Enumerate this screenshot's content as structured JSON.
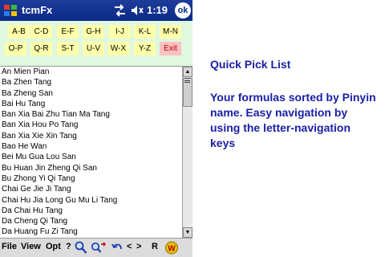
{
  "titlebar": {
    "app_title": "tcmFx",
    "time": "1:19",
    "ok_label": "ok"
  },
  "letter_nav": {
    "keys": [
      "A-B",
      "C-D",
      "E-F",
      "G-H",
      "I-J",
      "K-L",
      "M-N",
      "O-P",
      "Q-R",
      "S-T",
      "U-V",
      "W-X",
      "Y-Z"
    ],
    "exit_label": "Exit"
  },
  "list": {
    "items": [
      "An Mien Pian",
      "Ba Zhen Tang",
      "Ba Zheng San",
      "Bai Hu Tang",
      "Ban Xia Bai Zhu Tian Ma Tang",
      "Ban Xia Hou Po Tang",
      "Ban Xia Xie Xin Tang",
      "Bao He Wan",
      "Bei Mu Gua Lou San",
      "Bu Huan Jin Zheng Qi San",
      "Bu Zhong Yi Qi Tang",
      "Chai Ge Jie Ji Tang",
      "Chai Hu Jia Long Gu Mu Li Tang",
      "Da Chai Hu Tang",
      "Da Cheng Qi Tang",
      "Da Huang Fu Zi Tang"
    ]
  },
  "menubar": {
    "file": "File",
    "view": "View",
    "opt": "Opt",
    "help": "?",
    "nav_left": "<",
    "nav_right": ">",
    "r_label": "R"
  },
  "description": {
    "title": "Quick Pick List",
    "body": "Your formulas sorted by Pinyin name.  Easy navigation by using the letter-navigation keys"
  },
  "colors": {
    "titlebar": "#0a2a86",
    "letter_panel": "#dff8df",
    "letter_key": "#ffffaa",
    "exit_key": "#ffc0c0",
    "description_text": "#1a20a6"
  },
  "icons": [
    "windows-start-icon",
    "connectivity-icon",
    "volume-icon",
    "search-icon",
    "search-next-icon",
    "undo-icon",
    "bookmark-icon"
  ]
}
